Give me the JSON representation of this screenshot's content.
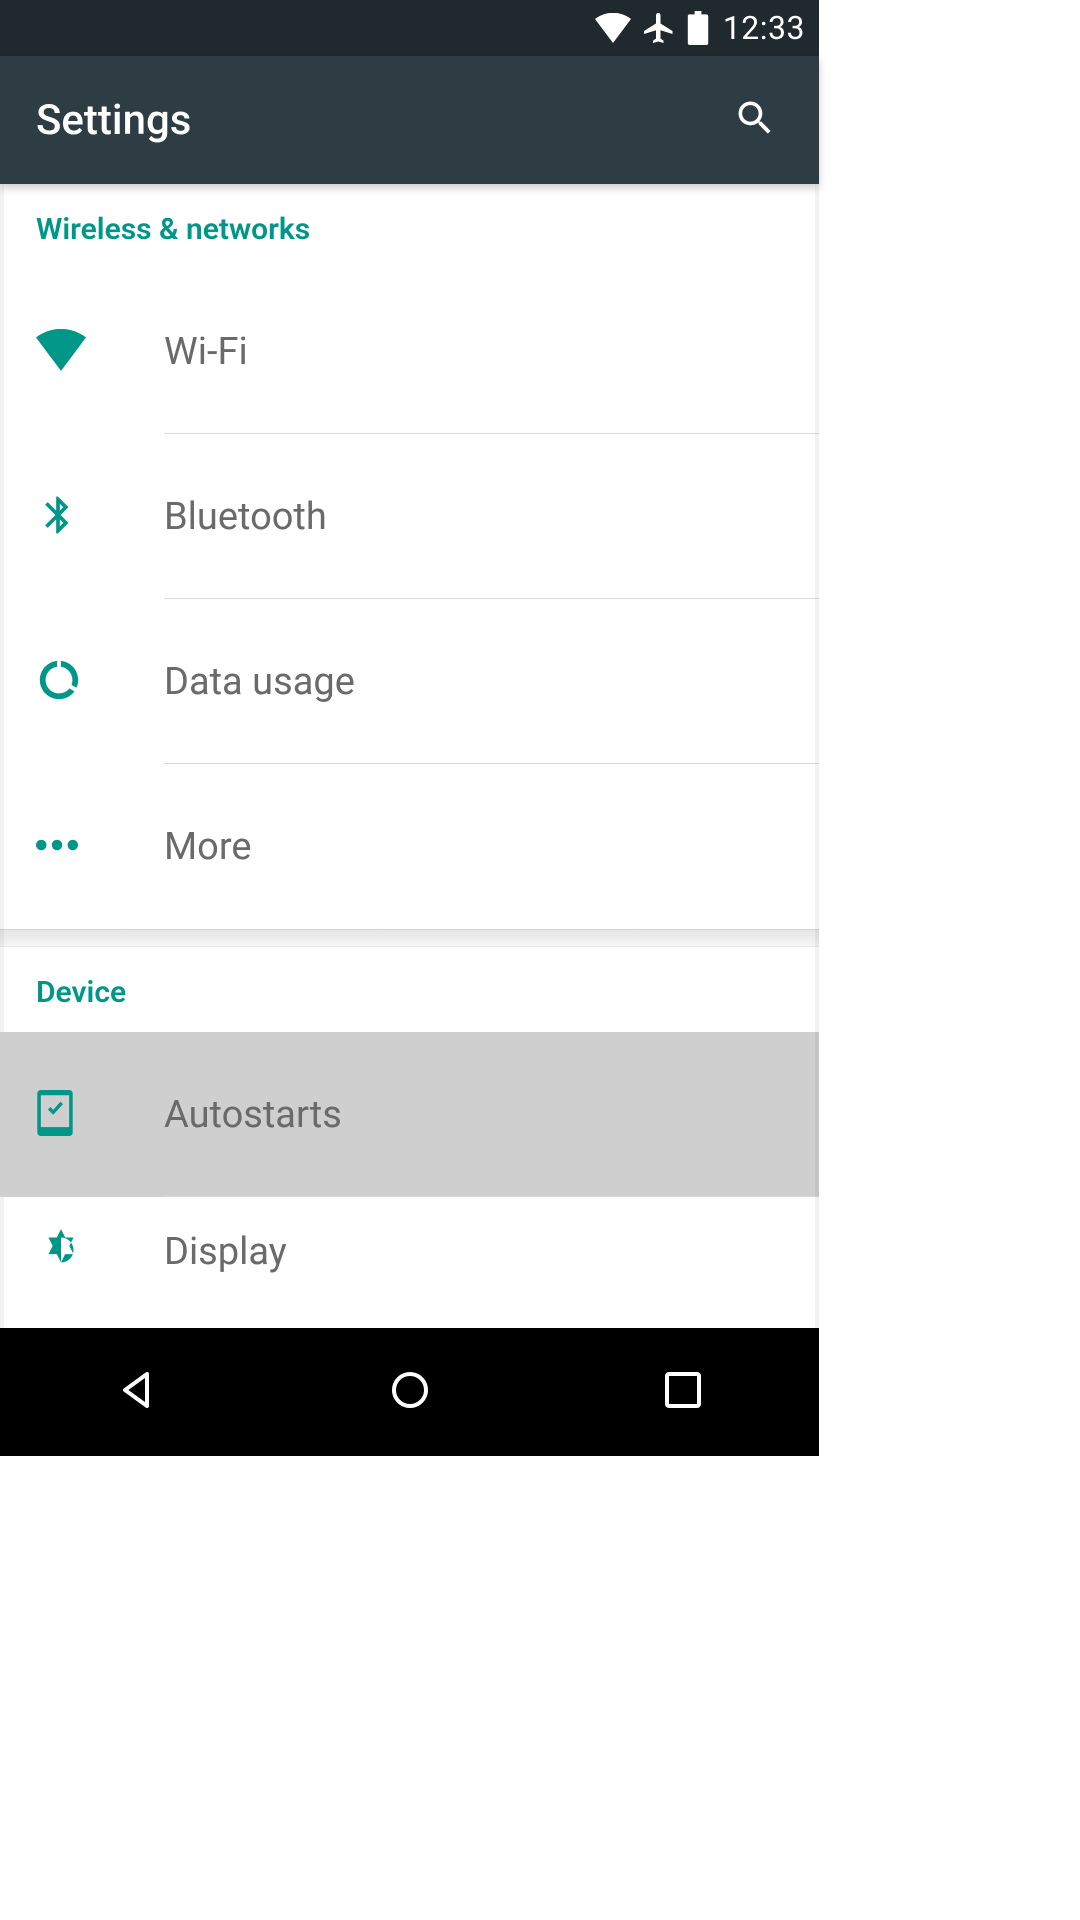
{
  "status": {
    "time": "12:33",
    "icons": [
      "wifi-icon",
      "airplane-icon",
      "battery-icon"
    ]
  },
  "appbar": {
    "title": "Settings",
    "search_aria": "Search"
  },
  "sections": [
    {
      "title": "Wireless & networks",
      "items": [
        {
          "icon": "wifi",
          "label": "Wi-Fi"
        },
        {
          "icon": "bluetooth",
          "label": "Bluetooth"
        },
        {
          "icon": "data-usage",
          "label": "Data usage"
        },
        {
          "icon": "more",
          "label": "More"
        }
      ]
    },
    {
      "title": "Device",
      "items": [
        {
          "icon": "autostarts",
          "label": "Autostarts",
          "highlight": true
        },
        {
          "icon": "display",
          "label": "Display"
        }
      ]
    }
  ],
  "colors": {
    "accent": "#009688",
    "appbar": "#2e3c43",
    "statusbar": "#1f292e"
  }
}
